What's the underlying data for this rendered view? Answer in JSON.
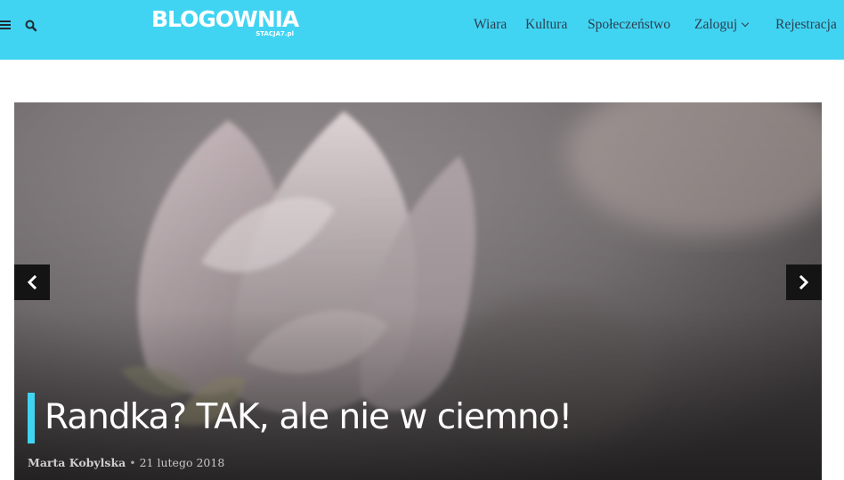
{
  "header": {
    "background_color": "#41d4f2",
    "menu_icon": "hamburger-menu-icon",
    "search_icon": "search-icon",
    "logo": {
      "main": "BLOGOWNIA",
      "sub": "STACJA7.pl"
    },
    "nav": {
      "wiara": "Wiara",
      "kultura": "Kultura",
      "spoleczenstwo": "Społeczeństwo",
      "zaloguj": "Zaloguj",
      "rejestracja": "Rejestracja"
    }
  },
  "slider": {
    "prev_icon": "chevron-left-icon",
    "next_icon": "chevron-right-icon",
    "accent_color": "#41d4f2",
    "post": {
      "title": "Randka? TAK, ale nie w ciemno!",
      "author": "Marta Kobylska",
      "separator": "•",
      "date": "21 lutego 2018"
    }
  }
}
